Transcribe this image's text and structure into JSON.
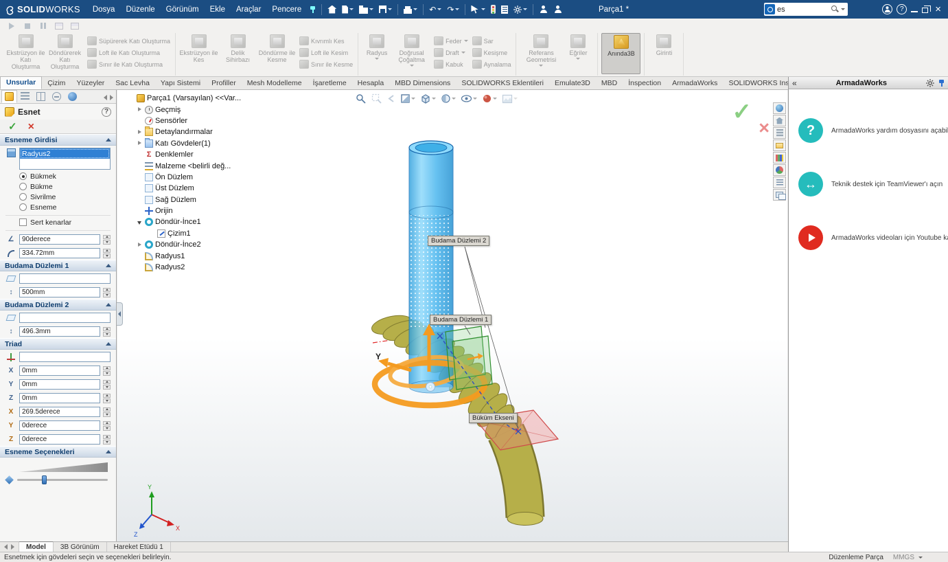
{
  "menubar": {
    "logo_bold": "SOLID",
    "logo_light": "WORKS",
    "menus": [
      "Dosya",
      "Düzenle",
      "Görünüm",
      "Ekle",
      "Araçlar",
      "Pencere"
    ],
    "document_title": "Parça1 *",
    "search_value": "es",
    "icons": [
      "home",
      "new-document",
      "open",
      "save",
      "print",
      "undo",
      "redo",
      "select",
      "rebuild",
      "file-properties",
      "options",
      "user"
    ]
  },
  "ribbon": {
    "groups": [
      {
        "big": [
          "Ekstrüzyon ile Katı Oluşturma",
          "Döndürerek Katı Oluşturma"
        ],
        "small": [
          "Süpürerek Katı Oluşturma",
          "Loft ile Katı Oluşturma",
          "Sınır ile Katı Oluşturma"
        ]
      },
      {
        "big": [
          "Ekstrüzyon ile Kes",
          "Delik Sihirbazı",
          "Döndürme ile Kesme"
        ],
        "small": [
          "Kıvrımlı Kes",
          "Loft ile Kesim",
          "Sınır ile Kesme"
        ]
      },
      {
        "big": [
          "Radyus",
          "Doğrusal Çoğaltma"
        ],
        "small": [
          "Feder",
          "Draft",
          "Kabuk"
        ],
        "small2": [
          "Sar",
          "Kesişme",
          "Aynalama"
        ]
      },
      {
        "big": [
          "Referans Geometrisi",
          "Eğriler"
        ]
      },
      {
        "big": [
          "Anında3B"
        ]
      },
      {
        "big": [
          "Girinti"
        ]
      }
    ]
  },
  "command_tabs": {
    "active": "Unsurlar",
    "items": [
      "Unsurlar",
      "Çizim",
      "Yüzeyler",
      "Sac Levha",
      "Yapı Sistemi",
      "Profiller",
      "Mesh Modelleme",
      "İşaretleme",
      "Hesapla",
      "MBD Dimensions",
      "SOLIDWORKS Eklentileri",
      "Emulate3D",
      "MBD",
      "İnspection",
      "ArmadaWorks",
      "SOLIDWORKS Inspection"
    ]
  },
  "property_manager": {
    "title": "Esnet",
    "esneme_girdisi": {
      "header": "Esneme Girdisi",
      "selection": "Radyus2",
      "radio_bukmek": "Bükmek",
      "radio_bukme": "Bükme",
      "radio_sivrilme": "Sivrilme",
      "radio_esneme": "Esneme",
      "hard_edges": "Sert kenarlar",
      "angle": "90derece",
      "radius": "334.72mm"
    },
    "budama1": {
      "header": "Budama Düzlemi 1",
      "plane": "",
      "offset": "500mm"
    },
    "budama2": {
      "header": "Budama Düzlemi 2",
      "plane": "",
      "offset": "496.3mm"
    },
    "triad": {
      "header": "Triad",
      "reference": "",
      "x": "0mm",
      "y": "0mm",
      "z": "0mm",
      "rot_x": "269.5derece",
      "rot_y": "0derece",
      "rot_z": "0derece"
    },
    "options": {
      "header": "Esneme Seçenekleri"
    }
  },
  "feature_tree": {
    "root": "Parça1 (Varsayılan) <<Var...",
    "items": [
      "Geçmiş",
      "Sensörler",
      "Detaylandırmalar",
      "Katı Gövdeler(1)",
      "Denklemler",
      "Malzeme <belirli değ...",
      "Ön Düzlem",
      "Üst Düzlem",
      "Sağ Düzlem",
      "Orijin",
      "Döndür-İnce1",
      "Çizim1",
      "Döndür-İnce2",
      "Radyus1",
      "Radyus2"
    ]
  },
  "viewport": {
    "callouts": {
      "trim2": "Budama Düzlemi 2",
      "trim1": "Budama Düzlemi 1",
      "bend_axis": "Büküm Ekseni"
    },
    "axis_label": "Y",
    "triad": {
      "x": "X",
      "y": "Y",
      "z": "Z"
    },
    "heads_up_icons": [
      "zoom-fit",
      "zoom-area",
      "previous-view",
      "section-view",
      "view-orientation",
      "display-style",
      "hide-show-items",
      "edit-appearance",
      "apply-scene"
    ]
  },
  "task_pane": {
    "title": "ArmadaWorks",
    "items": [
      {
        "icon": "help-circle",
        "text": "ArmadaWorks yardım dosyasını açabilirs"
      },
      {
        "icon": "teamviewer",
        "text": "Teknik destek için TeamViewer'ı açın"
      },
      {
        "icon": "youtube",
        "text": "ArmadaWorks videoları için Youtube kan"
      }
    ],
    "tab_strip_icons": [
      "resources",
      "home",
      "design-library",
      "file-explorer",
      "view-palette",
      "appearances",
      "custom-properties",
      "forum"
    ]
  },
  "bottom_tabs": {
    "active": "Model",
    "items": [
      "Model",
      "3B Görünüm",
      "Hareket Etüdü 1"
    ]
  },
  "status_bar": {
    "message": "Esnetmek için gövdeleri seçin ve seçenekleri belirleyin.",
    "mode": "Düzenleme Parça",
    "units": "MMGS"
  },
  "colors": {
    "menubar_blue": "#1b4d82",
    "selection_blue": "#2f80d4",
    "manipulator_orange": "#f49b20",
    "body_olive": "#b6af49",
    "body_cyan": "#45b4ee",
    "ok_green": "#3ea53e",
    "cancel_red": "#d23c2e",
    "teal": "#25bcbc",
    "youtube_red": "#e02b20"
  }
}
